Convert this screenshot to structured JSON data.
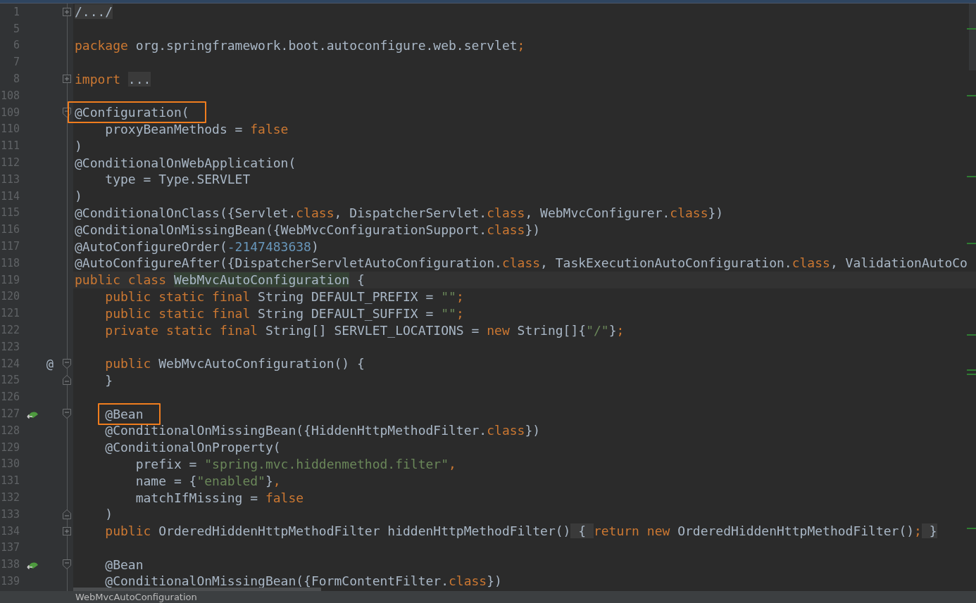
{
  "editor": {
    "lines": [
      {
        "number": "1",
        "fold": {
          "kind": "region",
          "collapsed": true
        },
        "tokens": [
          {
            "kind": "folded",
            "text": "/.../"
          }
        ]
      },
      {
        "number": "5"
      },
      {
        "number": "6",
        "tokens": [
          {
            "kind": "keyword",
            "text": "package "
          },
          {
            "kind": "plain",
            "text": "org.springframework.boot.autoconfigure.web.servlet"
          },
          {
            "kind": "keyword",
            "text": ";"
          }
        ]
      },
      {
        "number": "7"
      },
      {
        "number": "8",
        "fold": {
          "kind": "region",
          "collapsed": true
        },
        "tokens": [
          {
            "kind": "keyword",
            "text": "import "
          },
          {
            "kind": "folded",
            "text": "..."
          }
        ]
      },
      {
        "number": "108"
      },
      {
        "number": "109",
        "fold": {
          "kind": "region",
          "collapsed": false
        },
        "tokens": [
          {
            "kind": "plain",
            "text": "@Configuration(",
            "framed": true
          }
        ]
      },
      {
        "number": "110",
        "tokens": [
          {
            "kind": "plain",
            "text": "    proxyBeanMethods = "
          },
          {
            "kind": "keyword",
            "text": "false"
          }
        ]
      },
      {
        "number": "111",
        "tokens": [
          {
            "kind": "plain",
            "text": ")"
          }
        ]
      },
      {
        "number": "112",
        "tokens": [
          {
            "kind": "plain",
            "text": "@ConditionalOnWebApplication("
          }
        ]
      },
      {
        "number": "113",
        "tokens": [
          {
            "kind": "plain",
            "text": "    type = Type.SERVLET"
          }
        ]
      },
      {
        "number": "114",
        "tokens": [
          {
            "kind": "plain",
            "text": ")"
          }
        ]
      },
      {
        "number": "115",
        "tokens": [
          {
            "kind": "plain",
            "text": "@ConditionalOnClass({Servlet."
          },
          {
            "kind": "keyword",
            "text": "class"
          },
          {
            "kind": "plain",
            "text": ", DispatcherServlet."
          },
          {
            "kind": "keyword",
            "text": "class"
          },
          {
            "kind": "plain",
            "text": ", WebMvcConfigurer."
          },
          {
            "kind": "keyword",
            "text": "class"
          },
          {
            "kind": "plain",
            "text": "})"
          }
        ]
      },
      {
        "number": "116",
        "tokens": [
          {
            "kind": "plain",
            "text": "@ConditionalOnMissingBean({WebMvcConfigurationSupport."
          },
          {
            "kind": "keyword",
            "text": "class"
          },
          {
            "kind": "plain",
            "text": "})"
          }
        ]
      },
      {
        "number": "117",
        "tokens": [
          {
            "kind": "plain",
            "text": "@AutoConfigureOrder("
          },
          {
            "kind": "number",
            "text": "-2147483638"
          },
          {
            "kind": "plain",
            "text": ")"
          }
        ]
      },
      {
        "number": "118",
        "tokens": [
          {
            "kind": "plain",
            "text": "@AutoConfigureAfter({DispatcherServletAutoConfiguration."
          },
          {
            "kind": "keyword",
            "text": "class"
          },
          {
            "kind": "plain",
            "text": ", TaskExecutionAutoConfiguration."
          },
          {
            "kind": "keyword",
            "text": "class"
          },
          {
            "kind": "plain",
            "text": ", ValidationAutoCo"
          }
        ]
      },
      {
        "number": "119",
        "current": true,
        "tokens": [
          {
            "kind": "keyword",
            "text": "public class "
          },
          {
            "kind": "usage",
            "text": "WebMvcAutoConfiguration"
          },
          {
            "kind": "plain",
            "text": " {"
          }
        ]
      },
      {
        "number": "120",
        "tokens": [
          {
            "kind": "keyword",
            "text": "    public static final "
          },
          {
            "kind": "plain",
            "text": "String DEFAULT_PREFIX = "
          },
          {
            "kind": "string",
            "text": "\"\""
          },
          {
            "kind": "keyword",
            "text": ";"
          }
        ]
      },
      {
        "number": "121",
        "tokens": [
          {
            "kind": "keyword",
            "text": "    public static final "
          },
          {
            "kind": "plain",
            "text": "String DEFAULT_SUFFIX = "
          },
          {
            "kind": "string",
            "text": "\"\""
          },
          {
            "kind": "keyword",
            "text": ";"
          }
        ]
      },
      {
        "number": "122",
        "tokens": [
          {
            "kind": "keyword",
            "text": "    private static final "
          },
          {
            "kind": "plain",
            "text": "String[] SERVLET_LOCATIONS = "
          },
          {
            "kind": "keyword",
            "text": "new "
          },
          {
            "kind": "plain",
            "text": "String[]{"
          },
          {
            "kind": "string",
            "text": "\"/\""
          },
          {
            "kind": "plain",
            "text": "}"
          },
          {
            "kind": "keyword",
            "text": ";"
          }
        ]
      },
      {
        "number": "123"
      },
      {
        "number": "124",
        "marker": {
          "kind": "text",
          "text": "@"
        },
        "fold": {
          "kind": "region",
          "collapsed": false
        },
        "tokens": [
          {
            "kind": "keyword",
            "text": "    public "
          },
          {
            "kind": "plain",
            "text": "WebMvcAutoConfiguration() {"
          }
        ]
      },
      {
        "number": "125",
        "fold": {
          "kind": "end"
        },
        "tokens": [
          {
            "kind": "plain",
            "text": "    }"
          }
        ]
      },
      {
        "number": "126"
      },
      {
        "number": "127",
        "marker": {
          "kind": "bean"
        },
        "fold": {
          "kind": "region",
          "collapsed": false
        },
        "tokens": [
          {
            "kind": "plain",
            "text": "    @Bean",
            "framed": true
          }
        ]
      },
      {
        "number": "128",
        "tokens": [
          {
            "kind": "plain",
            "text": "    @ConditionalOnMissingBean({HiddenHttpMethodFilter."
          },
          {
            "kind": "keyword",
            "text": "class"
          },
          {
            "kind": "plain",
            "text": "})"
          }
        ]
      },
      {
        "number": "129",
        "tokens": [
          {
            "kind": "plain",
            "text": "    @ConditionalOnProperty("
          }
        ]
      },
      {
        "number": "130",
        "tokens": [
          {
            "kind": "plain",
            "text": "        prefix = "
          },
          {
            "kind": "string",
            "text": "\"spring.mvc.hiddenmethod.filter\""
          },
          {
            "kind": "keyword",
            "text": ","
          }
        ]
      },
      {
        "number": "131",
        "tokens": [
          {
            "kind": "plain",
            "text": "        name = {"
          },
          {
            "kind": "string",
            "text": "\"enabled\""
          },
          {
            "kind": "plain",
            "text": "}"
          },
          {
            "kind": "keyword",
            "text": ","
          }
        ]
      },
      {
        "number": "132",
        "tokens": [
          {
            "kind": "plain",
            "text": "        matchIfMissing = "
          },
          {
            "kind": "keyword",
            "text": "false"
          }
        ]
      },
      {
        "number": "133",
        "fold": {
          "kind": "end"
        },
        "tokens": [
          {
            "kind": "plain",
            "text": "    )"
          }
        ]
      },
      {
        "number": "134",
        "fold": {
          "kind": "region",
          "collapsed": true
        },
        "tokens": [
          {
            "kind": "keyword",
            "text": "    public "
          },
          {
            "kind": "plain",
            "text": "OrderedHiddenHttpMethodFilter hiddenHttpMethodFilter()"
          },
          {
            "kind": "folded",
            "text": " { "
          },
          {
            "kind": "keyword",
            "text": "return new "
          },
          {
            "kind": "plain",
            "text": "OrderedHiddenHttpMethodFilter()"
          },
          {
            "kind": "keyword",
            "text": ";"
          },
          {
            "kind": "folded",
            "text": " }"
          }
        ]
      },
      {
        "number": "137"
      },
      {
        "number": "138",
        "marker": {
          "kind": "bean"
        },
        "fold": {
          "kind": "region",
          "collapsed": false
        },
        "tokens": [
          {
            "kind": "plain",
            "text": "    @Bean"
          }
        ]
      },
      {
        "number": "139",
        "tokens": [
          {
            "kind": "plain",
            "text": "    @ConditionalOnMissingBean({FormContentFilter."
          },
          {
            "kind": "keyword",
            "text": "class"
          },
          {
            "kind": "plain",
            "text": "})"
          }
        ]
      }
    ]
  },
  "breadcrumb": "WebMvcAutoConfiguration"
}
